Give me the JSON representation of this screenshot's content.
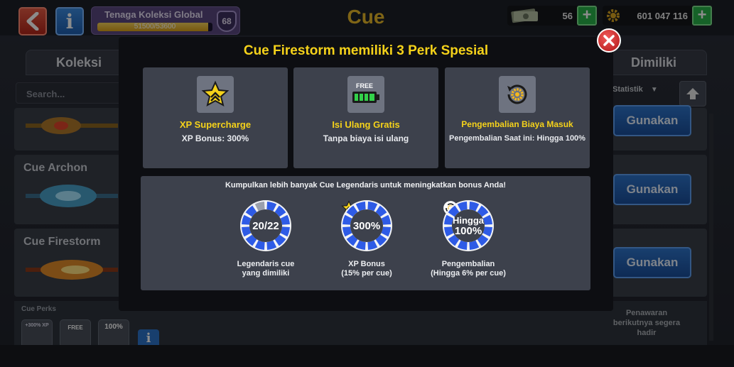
{
  "header": {
    "title": "Cue",
    "energy": {
      "label": "Tenaga Koleksi Global",
      "progress_text": "51500/53600",
      "progress_fraction": 0.961,
      "level": "68"
    },
    "cash": "56",
    "coins": "601 047 116"
  },
  "background": {
    "tabs": [
      "Koleksi",
      "Dimiliki"
    ],
    "search_placeholder": "Search...",
    "sort_label": "Statistik",
    "cues": [
      {
        "name": "",
        "button": "Gunakan"
      },
      {
        "name": "Cue Archon",
        "button": "Gunakan"
      },
      {
        "name": "Cue Firestorm",
        "button": "Gunakan"
      }
    ],
    "perks_title": "Cue Perks",
    "perk_minis": [
      "+300% XP",
      "FREE",
      "100%"
    ],
    "offer_text": "Penawaran berikutnya segera hadir"
  },
  "modal": {
    "title": "Cue Firestorm memiliki 3 Perk Spesial",
    "perks": [
      {
        "name": "XP Supercharge",
        "desc": "XP Bonus: 300%",
        "icon": "star-icon"
      },
      {
        "name": "Isi Ulang Gratis",
        "desc": "Tanpa biaya isi ulang",
        "icon": "battery-icon",
        "icon_text": "FREE"
      },
      {
        "name": "Pengembalian Biaya Masuk",
        "desc": "Pengembalian Saat ini: Hingga 100%",
        "icon": "refund-gear-icon"
      }
    ],
    "bonus_heading": "Kumpulkan lebih banyak Cue Legendaris untuk meningkatkan bonus Anda!",
    "stats": [
      {
        "value": "20/22",
        "label_line1": "Legendaris cue",
        "label_line2": "yang dimiliki",
        "fill": 0.91
      },
      {
        "value": "300%",
        "label_line1": "XP Bonus",
        "label_line2": "(15% per cue)",
        "fill": 1.0,
        "badge": "star-icon"
      },
      {
        "value_line1": "Hingga",
        "value_line2": "100%",
        "label_line1": "Pengembalian",
        "label_line2": "(Hingga 6% per cue)",
        "fill": 1.0,
        "badge": "refund-gear-icon"
      }
    ]
  },
  "colors": {
    "accent_yellow": "#f5d21a",
    "ring_blue": "#2e5be6",
    "button_blue": "#2d73c9",
    "plus_green": "#29b34a",
    "close_red": "#d12a2a"
  }
}
